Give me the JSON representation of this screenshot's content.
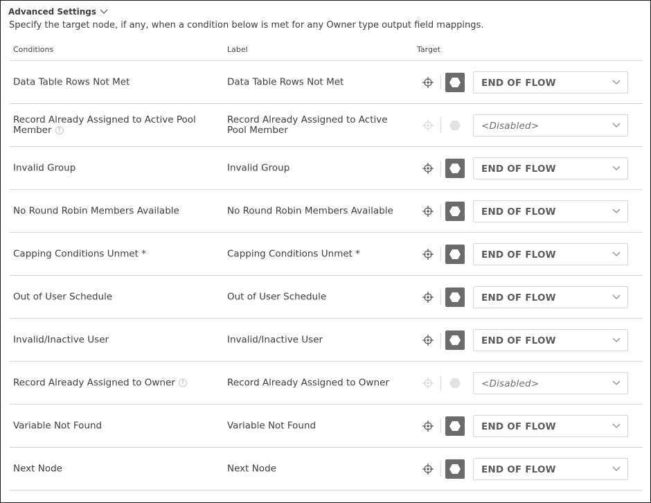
{
  "header": {
    "title": "Advanced Settings",
    "description": "Specify the target node, if any, when a condition below is met for any Owner type output field mappings."
  },
  "table": {
    "columns": [
      "Conditions",
      "Label",
      "Target"
    ],
    "rows": [
      {
        "condition": "Data Table Rows Not Met",
        "label": "Data Table Rows Not Met",
        "target": "END OF FLOW",
        "disabled": false,
        "help": false
      },
      {
        "condition": "Record Already Assigned to Active Pool Member",
        "label": "Record Already Assigned to Active Pool Member",
        "target": "<Disabled>",
        "disabled": true,
        "help": true
      },
      {
        "condition": "Invalid Group",
        "label": "Invalid Group",
        "target": "END OF FLOW",
        "disabled": false,
        "help": false
      },
      {
        "condition": "No Round Robin Members Available",
        "label": "No Round Robin Members Available",
        "target": "END OF FLOW",
        "disabled": false,
        "help": false
      },
      {
        "condition": "Capping Conditions Unmet *",
        "label": "Capping Conditions Unmet *",
        "target": "END OF FLOW",
        "disabled": false,
        "help": false
      },
      {
        "condition": "Out of User Schedule",
        "label": "Out of User Schedule",
        "target": "END OF FLOW",
        "disabled": false,
        "help": false
      },
      {
        "condition": "Invalid/Inactive User",
        "label": "Invalid/Inactive User",
        "target": "END OF FLOW",
        "disabled": false,
        "help": false
      },
      {
        "condition": "Record Already Assigned to Owner",
        "label": "Record Already Assigned to Owner",
        "target": "<Disabled>",
        "disabled": true,
        "help": true
      },
      {
        "condition": "Variable Not Found",
        "label": "Variable Not Found",
        "target": "END OF FLOW",
        "disabled": false,
        "help": false
      },
      {
        "condition": "Next Node",
        "label": "Next Node",
        "target": "END OF FLOW",
        "disabled": false,
        "help": false
      }
    ]
  },
  "help_icon_text": "?",
  "icons": {
    "header_toggle": "chevron-down-icon",
    "target": "crosshair-icon",
    "node": "hexagon-node-icon",
    "select": "chevron-down-icon",
    "help": "help-icon"
  },
  "colors": {
    "node_active": "#6b6b6b",
    "node_disabled": "#e2e2e2",
    "target_active": "#5a5a5a",
    "target_disabled": "#dadada"
  }
}
